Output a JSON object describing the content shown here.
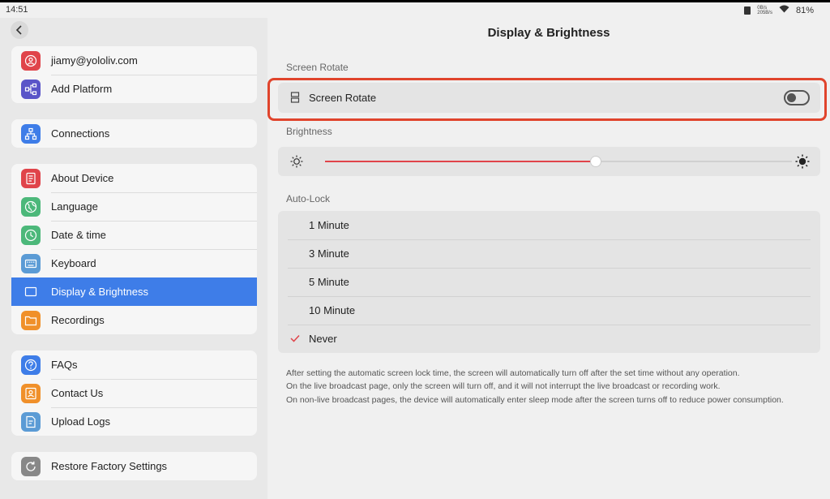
{
  "status_bar": {
    "time": "14:51",
    "net_up": "0B/s",
    "net_down": "205B/s",
    "battery": "81%"
  },
  "sidebar": {
    "back_icon": "chevron-left-icon",
    "groups": [
      [
        {
          "label": "jiamy@yololiv.com",
          "icon": "user-icon",
          "color": "#e0444a"
        },
        {
          "label": "Add Platform",
          "icon": "platform-icon",
          "color": "#5a55c8"
        }
      ],
      [
        {
          "label": "Connections",
          "icon": "network-icon",
          "color": "#3e7de8"
        }
      ],
      [
        {
          "label": "About Device",
          "icon": "device-info-icon",
          "color": "#e0444a"
        },
        {
          "label": "Language",
          "icon": "globe-icon",
          "color": "#4cb87a"
        },
        {
          "label": "Date & time",
          "icon": "clock-icon",
          "color": "#4cb87a"
        },
        {
          "label": "Keyboard",
          "icon": "keyboard-icon",
          "color": "#5b9bd5"
        },
        {
          "label": "Display & Brightness",
          "icon": "display-icon",
          "color": "#3e7de8",
          "active": true
        },
        {
          "label": "Recordings",
          "icon": "folder-icon",
          "color": "#f0902a"
        }
      ],
      [
        {
          "label": "FAQs",
          "icon": "question-icon",
          "color": "#3e7de8"
        },
        {
          "label": "Contact Us",
          "icon": "contact-icon",
          "color": "#f0902a"
        },
        {
          "label": "Upload Logs",
          "icon": "upload-log-icon",
          "color": "#5b9bd5"
        }
      ],
      [
        {
          "label": "Restore Factory Settings",
          "icon": "restore-icon",
          "color": "#888888"
        }
      ]
    ]
  },
  "main": {
    "title": "Display & Brightness",
    "screen_rotate": {
      "section": "Screen Rotate",
      "label": "Screen Rotate",
      "enabled": false
    },
    "brightness": {
      "section": "Brightness",
      "value": 0.58
    },
    "auto_lock": {
      "section": "Auto-Lock",
      "options": [
        "1 Minute",
        "3 Minute",
        "5 Minute",
        "10 Minute",
        "Never"
      ],
      "selected": "Never"
    },
    "note": [
      "After setting the automatic screen lock time, the screen will automatically turn off after the set time without any operation.",
      "On the live broadcast page, only the screen will turn off, and it will not interrupt the live broadcast or recording work.",
      "On non-live broadcast pages, the device will automatically enter sleep mode after the screen turns off to reduce power consumption."
    ]
  },
  "colors": {
    "accent": "#3e7de8",
    "highlight": "#e0442c",
    "slider_fill": "#e0444a",
    "check": "#e0444a"
  }
}
